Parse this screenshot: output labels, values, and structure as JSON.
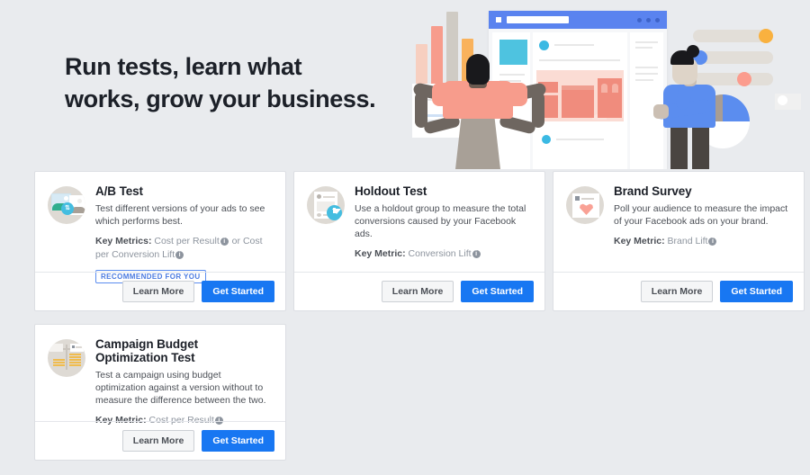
{
  "hero": {
    "title": "Run tests, learn what\nworks, grow your business.",
    "illustration_name": "experiments-hero-illustration"
  },
  "theme": {
    "page_bg": "#e9ebee",
    "card_bg": "#ffffff",
    "primary_blue": "#1877f2",
    "secondary_grey": "#f5f6f7",
    "badge_blue": "#4a7ae0",
    "text_dark": "#1c2028",
    "text_muted": "#8d949e"
  },
  "buttons": {
    "learn_more": "Learn More",
    "get_started": "Get Started"
  },
  "cards": [
    {
      "id": "ab-test",
      "icon": "ab-split-image-icon",
      "title": "A/B Test",
      "description": "Test different versions of your ads to see which performs best.",
      "metric_label": "Key Metrics:",
      "metric_value_1": "Cost per Result",
      "metric_conjunction": "or",
      "metric_value_2": "Cost per Conversion Lift",
      "badge": "RECOMMENDED FOR YOU",
      "learn_more": "Learn More",
      "get_started": "Get Started"
    },
    {
      "id": "holdout-test",
      "icon": "holdout-feed-arrow-icon",
      "title": "Holdout Test",
      "description": "Use a holdout group to measure the total conversions caused by your Facebook ads.",
      "metric_label": "Key Metric:",
      "metric_value_1": "Conversion Lift",
      "learn_more": "Learn More",
      "get_started": "Get Started"
    },
    {
      "id": "brand-survey",
      "icon": "brand-heart-post-icon",
      "title": "Brand Survey",
      "description": "Poll your audience to measure the impact of your Facebook ads on your brand.",
      "metric_label": "Key Metric:",
      "metric_value_1": "Brand Lift",
      "learn_more": "Learn More",
      "get_started": "Get Started"
    },
    {
      "id": "cbo-test",
      "icon": "budget-scale-coins-icon",
      "title": "Campaign Budget Optimization Test",
      "description": "Test a campaign using budget optimization against a version without to measure the difference between the two.",
      "metric_label": "Key Metric:",
      "metric_value_1": "Cost per Result",
      "learn_more": "Learn More",
      "get_started": "Get Started"
    }
  ]
}
